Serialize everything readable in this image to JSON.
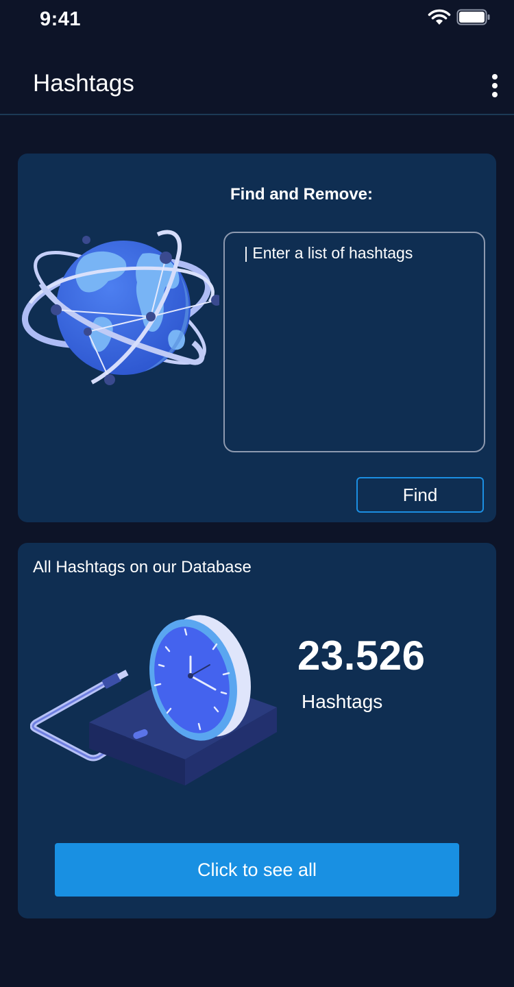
{
  "status_bar": {
    "time": "9:41"
  },
  "app_bar": {
    "title": "Hashtags"
  },
  "find_card": {
    "title": "Find and Remove:",
    "input_placeholder": "| Enter a list of hashtags",
    "input_value": "",
    "find_label": "Find"
  },
  "database_card": {
    "title": "All Hashtags on our Database",
    "count": "23.526",
    "unit": "Hashtags",
    "see_all_label": "Click to see all"
  },
  "colors": {
    "background": "#0d1428",
    "card": "#0f2e52",
    "accent": "#1990e2",
    "input_border": "#8e9ab0"
  },
  "icons": {
    "status": [
      "wifi-icon",
      "battery-icon"
    ],
    "app_bar": "more-vertical-icon",
    "illustrations": [
      "globe-illustration",
      "clock-database-illustration"
    ]
  }
}
